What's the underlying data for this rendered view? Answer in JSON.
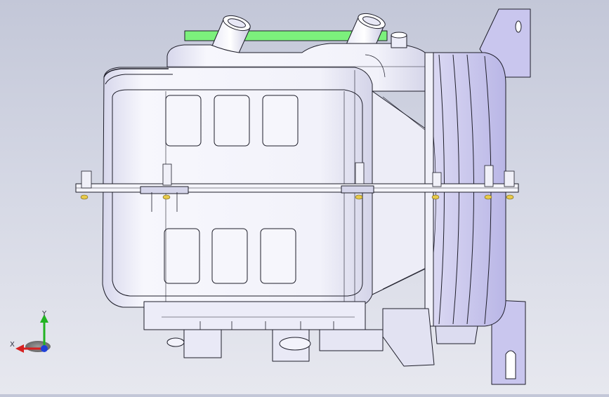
{
  "viewport": {
    "background_top": "#c3c7d8",
    "background_bottom": "#e7e8ef",
    "model_fill": "#f3f3fa",
    "model_shade": "#d9d9ee",
    "bracket_fill": "#c9c6ee",
    "gasket_color": "#7cf07c",
    "edge_color": "#1e1e2a",
    "fastener_color": "#e7c94a"
  },
  "triad": {
    "x_label": "X",
    "y_label": "Y",
    "x_color": "#d62020",
    "y_color": "#22b322",
    "z_color": "#2040d8"
  }
}
